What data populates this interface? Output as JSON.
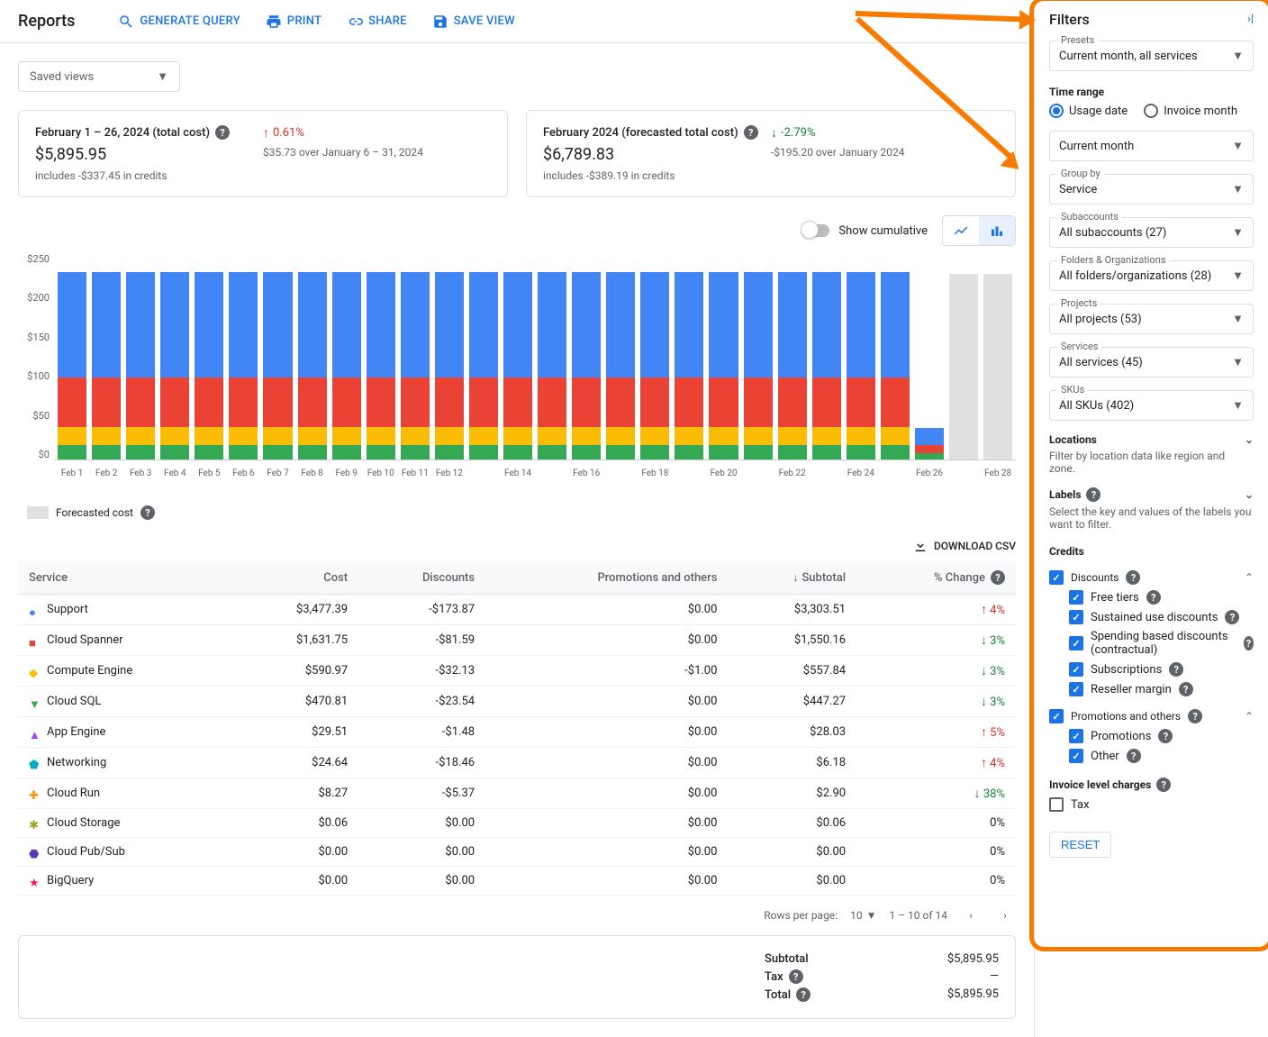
{
  "page_title": "Reports",
  "header_buttons": {
    "generate_query": "GENERATE QUERY",
    "print": "PRINT",
    "share": "SHARE",
    "save_view": "SAVE VIEW"
  },
  "saved_views_label": "Saved views",
  "summary": {
    "actual": {
      "title": "February 1 – 26, 2024 (total cost)",
      "amount": "$5,895.95",
      "sub": "includes -$337.45 in credits",
      "delta_pct": "0.61%",
      "delta_dir": "up",
      "delta_sub": "$35.73 over January 6 – 31, 2024"
    },
    "forecast": {
      "title": "February 2024 (forecasted total cost)",
      "amount": "$6,789.83",
      "sub": "includes -$389.19 in credits",
      "delta_pct": "-2.79%",
      "delta_dir": "down",
      "delta_sub": "-$195.20 over January 2024"
    }
  },
  "chart_controls": {
    "cumulative_label": "Show cumulative"
  },
  "legend_forecast": "Forecasted cost",
  "download_csv": "DOWNLOAD CSV",
  "table": {
    "headers": {
      "service": "Service",
      "cost": "Cost",
      "discounts": "Discounts",
      "promo": "Promotions and others",
      "subtotal": "Subtotal",
      "change": "% Change"
    },
    "rows": [
      {
        "service": "Support",
        "cost": "$3,477.39",
        "discounts": "-$173.87",
        "promo": "$0.00",
        "subtotal": "$3,303.51",
        "change": "4%",
        "dir": "up",
        "color": "#4285f4",
        "shape": "circle"
      },
      {
        "service": "Cloud Spanner",
        "cost": "$1,631.75",
        "discounts": "-$81.59",
        "promo": "$0.00",
        "subtotal": "$1,550.16",
        "change": "3%",
        "dir": "down",
        "color": "#ea4335",
        "shape": "square"
      },
      {
        "service": "Compute Engine",
        "cost": "$590.97",
        "discounts": "-$32.13",
        "promo": "-$1.00",
        "subtotal": "$557.84",
        "change": "3%",
        "dir": "down",
        "color": "#fbbc04",
        "shape": "diamond"
      },
      {
        "service": "Cloud SQL",
        "cost": "$470.81",
        "discounts": "-$23.54",
        "promo": "$0.00",
        "subtotal": "$447.27",
        "change": "3%",
        "dir": "down",
        "color": "#34a853",
        "shape": "triangle-down"
      },
      {
        "service": "App Engine",
        "cost": "$29.51",
        "discounts": "-$1.48",
        "promo": "$0.00",
        "subtotal": "$28.03",
        "change": "5%",
        "dir": "up",
        "color": "#a142f4",
        "shape": "triangle-up"
      },
      {
        "service": "Networking",
        "cost": "$24.64",
        "discounts": "-$18.46",
        "promo": "$0.00",
        "subtotal": "$6.18",
        "change": "4%",
        "dir": "up",
        "color": "#00acc1",
        "shape": "pentagon"
      },
      {
        "service": "Cloud Run",
        "cost": "$8.27",
        "discounts": "-$5.37",
        "promo": "$0.00",
        "subtotal": "$2.90",
        "change": "38%",
        "dir": "down",
        "color": "#ff8f00",
        "shape": "plus"
      },
      {
        "service": "Cloud Storage",
        "cost": "$0.06",
        "discounts": "$0.00",
        "promo": "$0.00",
        "subtotal": "$0.06",
        "change": "0%",
        "dir": "none",
        "color": "#9e9d24",
        "shape": "asterisk"
      },
      {
        "service": "Cloud Pub/Sub",
        "cost": "$0.00",
        "discounts": "$0.00",
        "promo": "$0.00",
        "subtotal": "$0.00",
        "change": "0%",
        "dir": "none",
        "color": "#5e35b1",
        "shape": "shield"
      },
      {
        "service": "BigQuery",
        "cost": "$0.00",
        "discounts": "$0.00",
        "promo": "$0.00",
        "subtotal": "$0.00",
        "change": "0%",
        "dir": "none",
        "color": "#e91e63",
        "shape": "star"
      }
    ],
    "pager": {
      "rpp_label": "Rows per page:",
      "rpp_value": "10",
      "range": "1 – 10 of 14"
    }
  },
  "totals": {
    "subtotal_label": "Subtotal",
    "subtotal": "$5,895.95",
    "tax_label": "Tax",
    "tax": "—",
    "total_label": "Total",
    "total": "$5,895.95"
  },
  "filters": {
    "title": "Filters",
    "presets": {
      "label": "Presets",
      "value": "Current month, all services"
    },
    "time_range": {
      "title": "Time range",
      "usage": "Usage date",
      "invoice": "Invoice month",
      "selected": "usage",
      "value": "Current month"
    },
    "group_by": {
      "label": "Group by",
      "value": "Service"
    },
    "subaccounts": {
      "label": "Subaccounts",
      "value": "All subaccounts (27)"
    },
    "folders": {
      "label": "Folders & Organizations",
      "value": "All folders/organizations (28)"
    },
    "projects": {
      "label": "Projects",
      "value": "All projects (53)"
    },
    "services": {
      "label": "Services",
      "value": "All services (45)"
    },
    "skus": {
      "label": "SKUs",
      "value": "All SKUs (402)"
    },
    "locations": {
      "title": "Locations",
      "hint": "Filter by location data like region and zone."
    },
    "labels": {
      "title": "Labels",
      "hint": "Select the key and values of the labels you want to filter."
    },
    "credits": {
      "title": "Credits",
      "discounts": {
        "label": "Discounts",
        "checked": true,
        "items": [
          {
            "label": "Free tiers",
            "checked": true
          },
          {
            "label": "Sustained use discounts",
            "checked": true
          },
          {
            "label": "Spending based discounts (contractual)",
            "checked": true
          },
          {
            "label": "Subscriptions",
            "checked": true
          },
          {
            "label": "Reseller margin",
            "checked": true
          }
        ]
      },
      "promos": {
        "label": "Promotions and others",
        "checked": true,
        "items": [
          {
            "label": "Promotions",
            "checked": true
          },
          {
            "label": "Other",
            "checked": true
          }
        ]
      }
    },
    "invoice_charges": {
      "title": "Invoice level charges",
      "tax_label": "Tax",
      "tax_checked": false
    },
    "reset": "RESET"
  },
  "chart_data": {
    "type": "bar",
    "ylabel_prefix": "$",
    "ylim": [
      0,
      250
    ],
    "yticks": [
      "$250",
      "$200",
      "$150",
      "$100",
      "$50",
      "$0"
    ],
    "categories": [
      "Feb 1",
      "Feb 2",
      "Feb 3",
      "Feb 4",
      "Feb 5",
      "Feb 6",
      "Feb 7",
      "Feb 8",
      "Feb 9",
      "Feb 10",
      "Feb 11",
      "Feb 12",
      "",
      "Feb 14",
      "",
      "Feb 16",
      "",
      "Feb 18",
      "",
      "Feb 20",
      "",
      "Feb 22",
      "",
      "Feb 24",
      "",
      "Feb 26",
      "",
      "Feb 28"
    ],
    "colors": {
      "Support": "#4285f4",
      "Cloud Spanner": "#ea4335",
      "Compute Engine": "#fbbc04",
      "Cloud SQL": "#34a853",
      "Other": "#a142f4",
      "Forecast": "#e0e0e0"
    },
    "series": [
      {
        "name": "Cloud SQL",
        "values": [
          17,
          17,
          17,
          17,
          17,
          17,
          17,
          17,
          17,
          17,
          17,
          17,
          17,
          17,
          17,
          17,
          17,
          17,
          17,
          17,
          17,
          17,
          17,
          17,
          17,
          8,
          0,
          0
        ]
      },
      {
        "name": "Compute Engine",
        "values": [
          22,
          22,
          22,
          22,
          22,
          22,
          22,
          22,
          22,
          22,
          22,
          22,
          22,
          22,
          22,
          22,
          22,
          22,
          22,
          22,
          22,
          22,
          22,
          22,
          22,
          0,
          0,
          0
        ]
      },
      {
        "name": "Cloud Spanner",
        "values": [
          60,
          60,
          60,
          60,
          60,
          60,
          60,
          60,
          60,
          60,
          60,
          60,
          60,
          60,
          60,
          60,
          60,
          60,
          60,
          60,
          60,
          60,
          60,
          60,
          60,
          10,
          0,
          0
        ]
      },
      {
        "name": "Support",
        "values": [
          128,
          128,
          128,
          128,
          128,
          128,
          128,
          128,
          128,
          128,
          128,
          128,
          128,
          128,
          128,
          128,
          128,
          128,
          128,
          128,
          128,
          128,
          128,
          128,
          128,
          20,
          0,
          0
        ]
      }
    ],
    "forecast": [
      0,
      0,
      0,
      0,
      0,
      0,
      0,
      0,
      0,
      0,
      0,
      0,
      0,
      0,
      0,
      0,
      0,
      0,
      0,
      0,
      0,
      0,
      0,
      0,
      0,
      0,
      225,
      225
    ]
  }
}
